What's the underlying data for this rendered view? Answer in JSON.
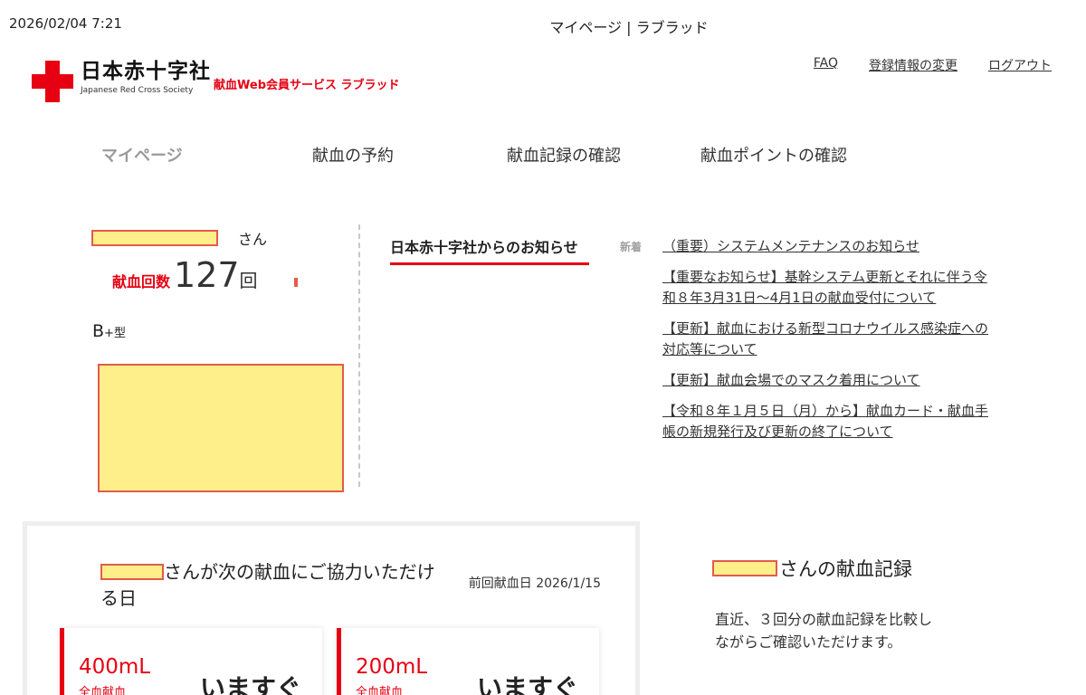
{
  "print": {
    "date": "2026/02/04 7:21",
    "title": "マイページ | ラブラッド"
  },
  "header": {
    "logo_jp": "日本赤十字社",
    "logo_en": "Japanese Red Cross Society",
    "service_name": "献血Web会員サービス ラブラッド",
    "links": {
      "faq": "FAQ",
      "edit_profile": "登録情報の変更",
      "logout": "ログアウト"
    }
  },
  "nav": {
    "mypage": "マイページ",
    "reserve": "献血の予約",
    "records": "献血記録の確認",
    "points": "献血ポイントの確認"
  },
  "profile": {
    "honorific": "さん",
    "count_label": "献血回数",
    "count_value": "127",
    "count_unit": "回",
    "blood_type": "B",
    "blood_type_rh": "+型"
  },
  "news": {
    "heading": "日本赤十字社からのお知らせ",
    "new_label": "新着",
    "items": [
      "（重要）システムメンテナンスのお知らせ",
      "【重要なお知らせ】基幹システム更新とそれに伴う令和８年3月31日～4月1日の献血受付について",
      "【更新】献血における新型コロナウイルス感染症への対応等について",
      "【更新】献血会場でのマスク着用について",
      "【令和８年１月５日（月）から】献血カード・献血手帳の新規発行及び更新の終了について"
    ]
  },
  "next_donation": {
    "title_suffix": "さんが次の献血にご協力いただける日",
    "last_date_label": "前回献血日 2026/1/15",
    "cards": [
      {
        "volume": "400mL",
        "type": "全血献血",
        "status": "いますぐ"
      },
      {
        "volume": "200mL",
        "type": "全血献血",
        "status": "いますぐ"
      }
    ]
  },
  "records": {
    "title_suffix": "さんの献血記録",
    "description": "直近、３回分の献血記録を比較しながらご確認いただけます。"
  },
  "colors": {
    "brand_red": "#e60012",
    "redact_fill": "#ffef8a",
    "redact_border": "#e25b4c"
  }
}
